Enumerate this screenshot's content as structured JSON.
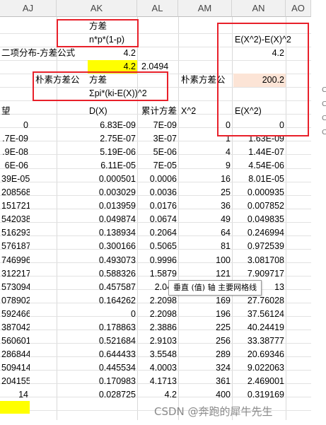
{
  "columns": [
    "AJ",
    "AK",
    "AL",
    "AM",
    "AN",
    "AO"
  ],
  "cells": {
    "ak_title": "方差",
    "ak_formula": "n*p*(1-p)",
    "aj_binom_label": "二项分布-方差公式",
    "ak_val1": "4.2",
    "ak_val2": "4.2",
    "al_val2": "2.0494",
    "aj_naive_label": "朴素方差公",
    "ak_naive_title": "方差",
    "ak_naive_formula": "Σpi*(ki-E(X))^2",
    "am_naive_label": "朴素方差公",
    "an_naive_val": "200.2",
    "an_formula": "E(X^2)-E(X)^2",
    "an_formula_val": "4.2",
    "aj_hdr": "望",
    "ak_hdr": "D(X)",
    "al_hdr": "累计方差",
    "am_hdr": "X^2",
    "an_hdr": "E(X^2)",
    "aj_bottom": "14"
  },
  "rows": [
    {
      "aj": "0",
      "ak": "6.83E-09",
      "al": "7E-09",
      "am": "0",
      "an": "0"
    },
    {
      "aj": ".7E-09",
      "ak": "2.75E-07",
      "al": "3E-07",
      "am": "1",
      "an": "1.63E-09"
    },
    {
      "aj": ".9E-08",
      "ak": "5.19E-06",
      "al": "5E-06",
      "am": "4",
      "an": "1.44E-07"
    },
    {
      "aj": "6E-06",
      "ak": "6.11E-05",
      "al": "7E-05",
      "am": "9",
      "an": "4.54E-06"
    },
    {
      "aj": "39E-05",
      "ak": "0.000501",
      "al": "0.0006",
      "am": "16",
      "an": "8.01E-05"
    },
    {
      "aj": "208568",
      "ak": "0.003029",
      "al": "0.0036",
      "am": "25",
      "an": "0.000935"
    },
    {
      "aj": "151721",
      "ak": "0.013959",
      "al": "0.0176",
      "am": "36",
      "an": "0.007852"
    },
    {
      "aj": "542038",
      "ak": "0.049874",
      "al": "0.0674",
      "am": "49",
      "an": "0.049835"
    },
    {
      "aj": "516293",
      "ak": "0.138934",
      "al": "0.2064",
      "am": "64",
      "an": "0.246994"
    },
    {
      "aj": "576187",
      "ak": "0.300166",
      "al": "0.5065",
      "am": "81",
      "an": "0.972539"
    },
    {
      "aj": "746996",
      "ak": "0.493073",
      "al": "0.9996",
      "am": "100",
      "an": "3.081708"
    },
    {
      "aj": "312217",
      "ak": "0.588326",
      "al": "1.5879",
      "am": "121",
      "an": "7.909717"
    },
    {
      "aj": "573094",
      "ak": "0.457587",
      "al": "2.045",
      "am": "",
      "an": "13"
    },
    {
      "aj": "078902",
      "ak": "0.164262",
      "al": "2.2098",
      "am": "169",
      "an": "27.76028"
    },
    {
      "aj": "592466",
      "ak": "0",
      "al": "2.2098",
      "am": "196",
      "an": "37.56124"
    },
    {
      "aj": "387042",
      "ak": "0.178863",
      "al": "2.3886",
      "am": "225",
      "an": "40.24419"
    },
    {
      "aj": "560601",
      "ak": "0.521684",
      "al": "2.9103",
      "am": "256",
      "an": "33.38777"
    },
    {
      "aj": "286844",
      "ak": "0.644433",
      "al": "3.5548",
      "am": "289",
      "an": "20.69346"
    },
    {
      "aj": "509414",
      "ak": "0.445534",
      "al": "4.0003",
      "am": "324",
      "an": "9.022063"
    },
    {
      "aj": "204155",
      "ak": "0.170983",
      "al": "4.1713",
      "am": "361",
      "an": "2.469001"
    },
    {
      "aj": "14",
      "ak": "0.028725",
      "al": "4.2",
      "am": "400",
      "an": "0.319169"
    }
  ],
  "tooltip": "垂直 (值) 轴 主要网格线",
  "watermark": "CSDN @奔跑的犀牛先生",
  "sidebar_marks": [
    "C",
    "C",
    "C",
    "C"
  ],
  "colors": {
    "highlight_yellow": "#ffff00",
    "highlight_peach": "#fce4d6",
    "annotation_red": "#e8202a"
  }
}
